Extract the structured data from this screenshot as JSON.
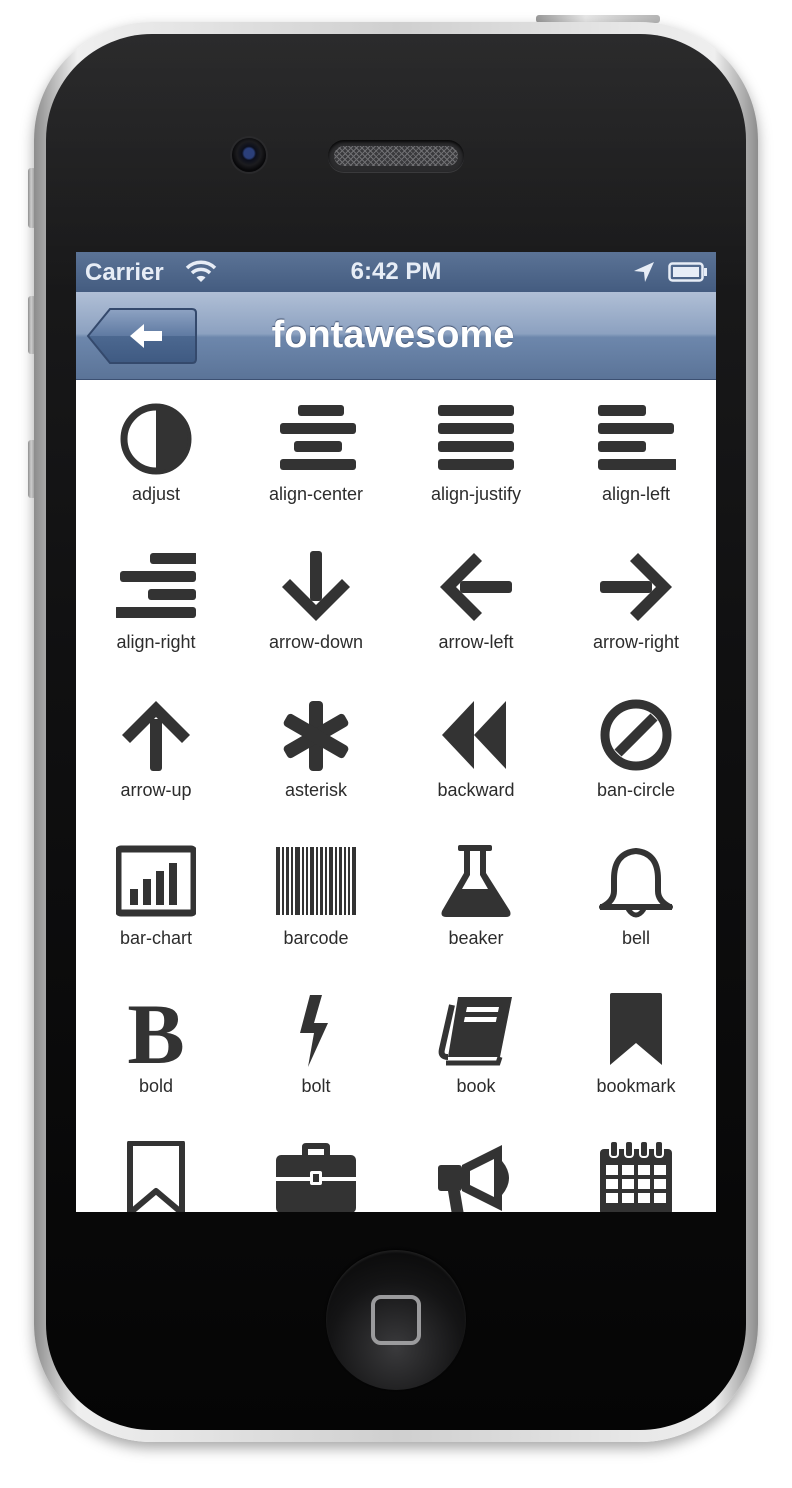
{
  "status_bar": {
    "carrier": "Carrier",
    "time": "6:42 PM"
  },
  "nav_bar": {
    "title": "fontawesome",
    "back_icon": "arrow-left-icon"
  },
  "icons": [
    {
      "label": "adjust"
    },
    {
      "label": "align-center"
    },
    {
      "label": "align-justify"
    },
    {
      "label": "align-left"
    },
    {
      "label": "align-right"
    },
    {
      "label": "arrow-down"
    },
    {
      "label": "arrow-left"
    },
    {
      "label": "arrow-right"
    },
    {
      "label": "arrow-up"
    },
    {
      "label": "asterisk"
    },
    {
      "label": "backward"
    },
    {
      "label": "ban-circle"
    },
    {
      "label": "bar-chart"
    },
    {
      "label": "barcode"
    },
    {
      "label": "beaker"
    },
    {
      "label": "bell"
    },
    {
      "label": "bold"
    },
    {
      "label": "bolt"
    },
    {
      "label": "book"
    },
    {
      "label": "bookmark"
    },
    {
      "label": "bookmark-empty"
    },
    {
      "label": "briefcase"
    },
    {
      "label": "bullhorn"
    },
    {
      "label": "calendar"
    }
  ],
  "colors": {
    "icon": "#333333",
    "nav_bar": "#6d87ac",
    "status_bar": "#445c80"
  }
}
